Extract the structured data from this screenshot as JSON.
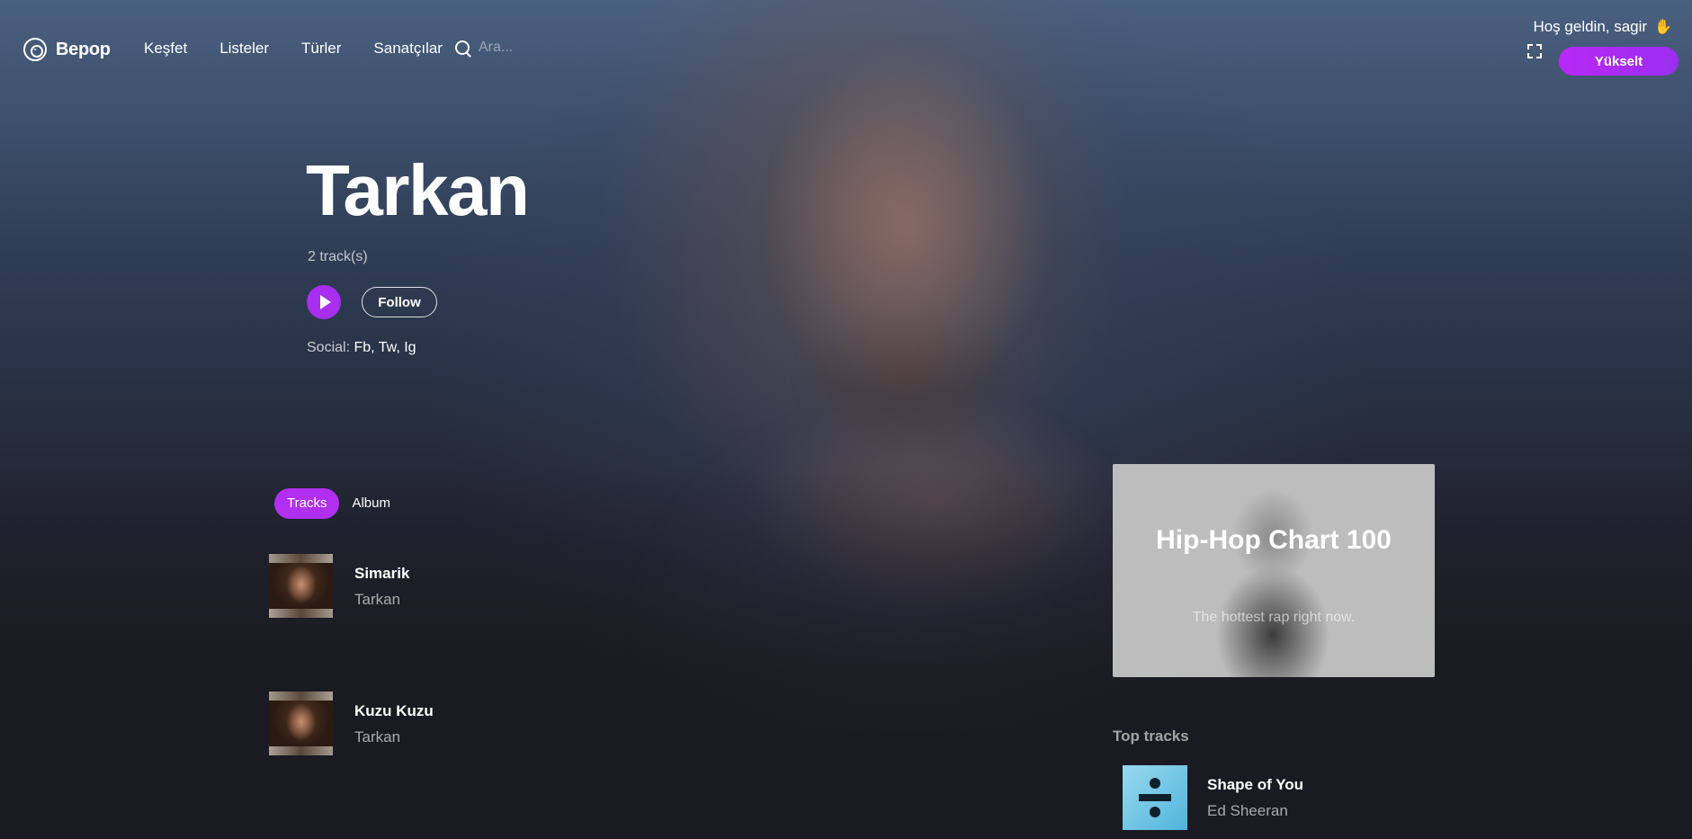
{
  "brand": {
    "name": "Bepop"
  },
  "nav": {
    "links": [
      "Keşfet",
      "Listeler",
      "Türler",
      "Sanatçılar"
    ],
    "search_placeholder": "Ara...",
    "welcome": "Hoş geldin, sagir",
    "upgrade_label": "Yükselt"
  },
  "artist": {
    "name": "Tarkan",
    "track_count": "2 track(s)",
    "follow_label": "Follow",
    "social_label": "Social:",
    "social_links": "Fb, Tw, Ig"
  },
  "tabs": [
    {
      "label": "Tracks",
      "active": true
    },
    {
      "label": "Album",
      "active": false
    }
  ],
  "tracks": [
    {
      "title": "Simarik",
      "artist": "Tarkan"
    },
    {
      "title": "Kuzu Kuzu",
      "artist": "Tarkan"
    }
  ],
  "chart_card": {
    "title": "Hip-Hop Chart 100",
    "subtitle": "The hottest rap right now."
  },
  "top_tracks": {
    "heading": "Top tracks",
    "items": [
      {
        "title": "Shape of You",
        "artist": "Ed Sheeran"
      }
    ]
  },
  "colors": {
    "accent": "#b12ff0",
    "background": "#1a1b22"
  },
  "icons": {
    "logo": "vinyl-icon",
    "search": "search-icon",
    "fullscreen": "fullscreen-icon",
    "wave": "wave-icon",
    "play": "play-icon"
  }
}
